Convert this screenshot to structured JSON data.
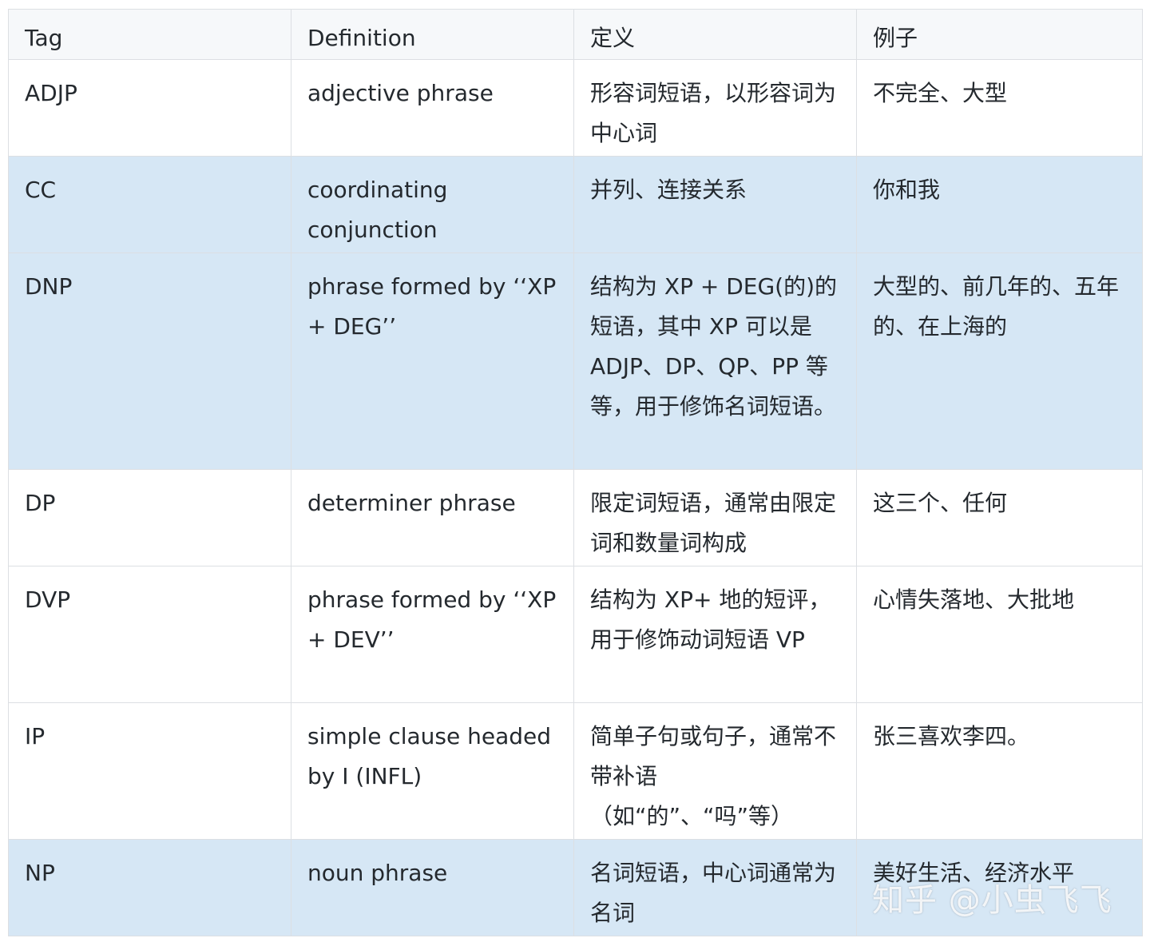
{
  "table": {
    "headers": [
      "Tag",
      "Definition",
      "定义",
      "例子"
    ],
    "rows": [
      {
        "tag": "ADJP",
        "definition": "adjective phrase",
        "dingyi": "形容词短语，以形容词为中心词",
        "lizi": "不完全、大型"
      },
      {
        "tag": "CC",
        "definition": "coordinating conjunction",
        "dingyi": "并列、连接关系",
        "lizi": "你和我"
      },
      {
        "tag": "DNP",
        "definition": "phrase formed by ‘‘XP + DEG’’",
        "dingyi": "结构为 XP + DEG(的)的短语，其中 XP 可以是 ADJP、DP、QP、PP 等等，用于修饰名词短语。",
        "lizi": "大型的、前几年的、五年的、在上海的"
      },
      {
        "tag": "DP",
        "definition": "determiner phrase",
        "dingyi": "限定词短语，通常由限定词和数量词构成",
        "lizi": "这三个、任何"
      },
      {
        "tag": "DVP",
        "definition": "phrase formed by ‘‘XP + DEV’’",
        "dingyi": "结构为 XP+ 地的短评，用于修饰动词短语 VP",
        "lizi": "心情失落地、大批地"
      },
      {
        "tag": "IP",
        "definition": "simple clause headed by I (INFL)",
        "dingyi": "简单子句或句子，通常不带补语（如“的”、“吗”等）",
        "lizi": "张三喜欢李四。"
      },
      {
        "tag": "NP",
        "definition": "noun phrase",
        "dingyi": "名词短语，中心词通常为名词",
        "lizi": "美好生活、经济水平"
      }
    ]
  },
  "watermark": "知乎 @小虫飞飞"
}
